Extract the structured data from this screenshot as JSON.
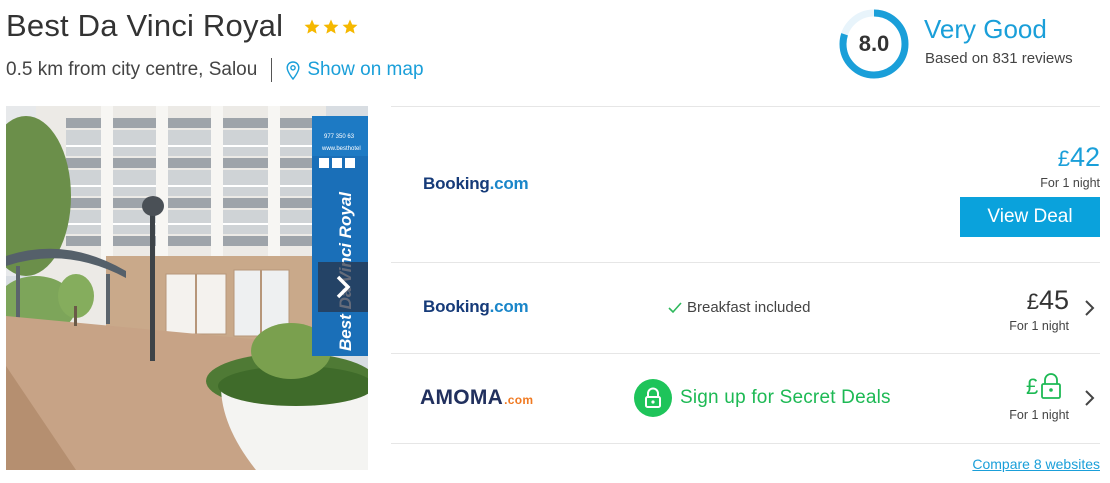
{
  "hotel": {
    "name": "Best Da Vinci Royal",
    "star_count": 3,
    "star_color": "#f5b800",
    "distance": "0.5 km from city centre, Salou",
    "map_link": "Show on map"
  },
  "rating": {
    "score": "8.0",
    "verdict": "Very Good",
    "reviews": "Based on 831 reviews",
    "ring_fraction": 0.8,
    "ring_color": "#1a9fd9"
  },
  "photo": {
    "sign_text": "Best Da Vinci Royal",
    "sign_phone": "977 350 63",
    "sign_web": "www.besthotel"
  },
  "deals": [
    {
      "provider_main": "Booking",
      "provider_suffix": ".com",
      "currency": "£",
      "amount": "42",
      "per_night": "For 1 night",
      "button": "View Deal"
    },
    {
      "provider_main": "Booking",
      "provider_suffix": ".com",
      "feature": "Breakfast included",
      "currency": "£",
      "amount": "45",
      "per_night": "For 1 night"
    },
    {
      "provider_main": "AMOMA",
      "provider_suffix": ".com",
      "feature": "Sign up for Secret Deals",
      "currency": "£",
      "per_night": "For 1 night"
    }
  ],
  "compare": "Compare 8 websites",
  "colors": {
    "accent": "#1a9fd9",
    "button": "#0aa2dc",
    "secret_green": "#1db954"
  },
  "icons": {
    "star": "star-icon",
    "map": "map-pin-icon",
    "check": "check-icon",
    "lock": "lock-icon",
    "chevron": "chevron-right-icon"
  }
}
